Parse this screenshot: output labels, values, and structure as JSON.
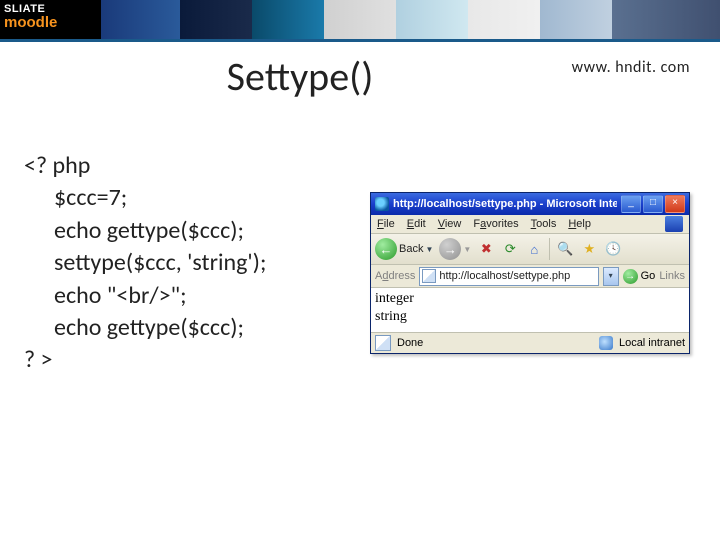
{
  "banner": {
    "logo_line1": "SLIATE",
    "logo_line2": "moodle"
  },
  "header": {
    "title": "Settype()",
    "url": "www. hndit. com"
  },
  "code": {
    "l1": "<? php",
    "l2": "$ccc=7;",
    "l3": "echo gettype($ccc);",
    "l4": "settype($ccc, 'string');",
    "l5": "echo \"<br/>\";",
    "l6": "echo gettype($ccc);",
    "l7": "? >"
  },
  "ie": {
    "title": "http://localhost/settype.php - Microsoft Inter...",
    "menu": {
      "file": "File",
      "edit": "Edit",
      "view": "View",
      "favorites": "Favorites",
      "tools": "Tools",
      "help": "Help"
    },
    "toolbar": {
      "back": "Back"
    },
    "address": {
      "label": "Address",
      "value": "http://localhost/settype.php",
      "go": "Go",
      "links": "Links"
    },
    "output": {
      "line1": "integer",
      "line2": "string"
    },
    "status": {
      "done": "Done",
      "zone": "Local intranet"
    }
  }
}
